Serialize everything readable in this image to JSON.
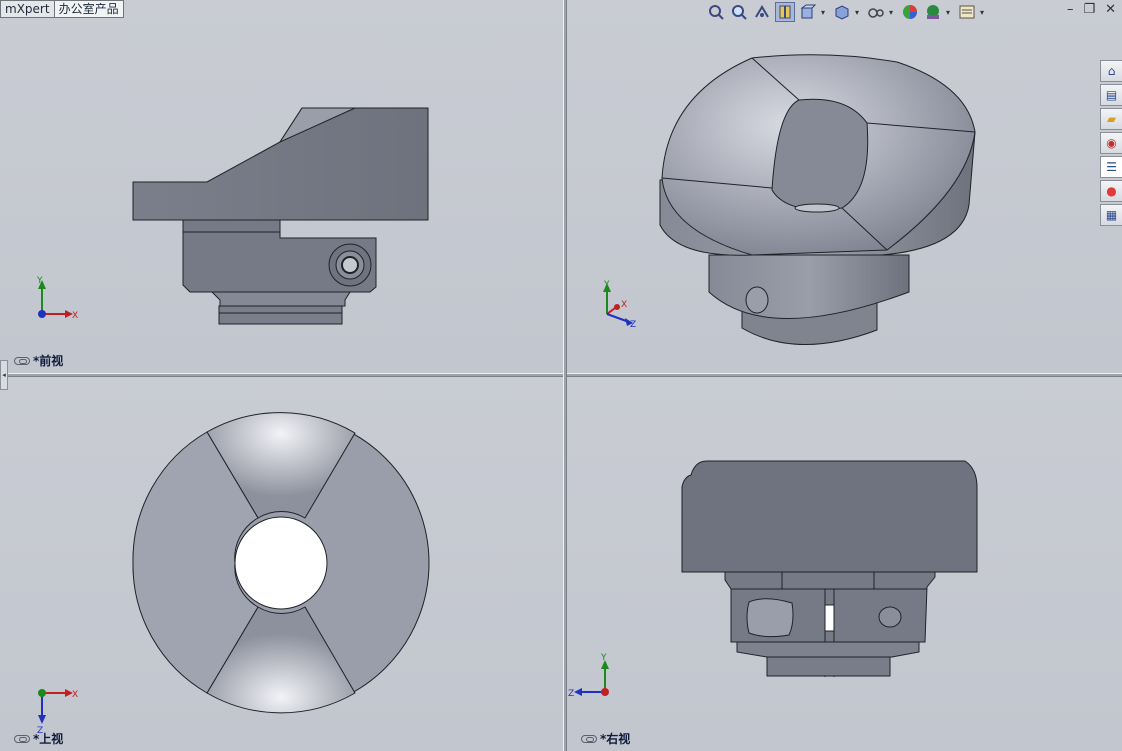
{
  "tabs": [
    {
      "label": "mXpert"
    },
    {
      "label": "办公室产品"
    }
  ],
  "viewports": {
    "front": {
      "label": "*前视"
    },
    "iso": {
      "label": ""
    },
    "top": {
      "label": "*上视"
    },
    "right": {
      "label": "*右视"
    }
  },
  "triad": {
    "x": "X",
    "y": "Y",
    "z": "Z"
  },
  "toolbar": [
    "zoom-to-fit-icon",
    "zoom-area-icon",
    "previous-view-icon",
    "section-view-icon",
    "view-orientation-icon",
    "display-style-icon",
    "hide-show-icon",
    "edit-appearance-icon",
    "apply-scene-icon",
    "view-settings-icon"
  ],
  "window_controls": {
    "minimize": "–",
    "restore": "❐",
    "close": "✕"
  },
  "task_pane": [
    "home-icon",
    "design-library-icon",
    "file-explorer-icon",
    "search-icon",
    "view-palette-icon",
    "appearances-icon",
    "custom-properties-icon"
  ],
  "colors": {
    "part_fill": "#7e8290",
    "part_light": "#b9bcc7",
    "edge": "#1f2228",
    "bg": "#c6cad2"
  }
}
